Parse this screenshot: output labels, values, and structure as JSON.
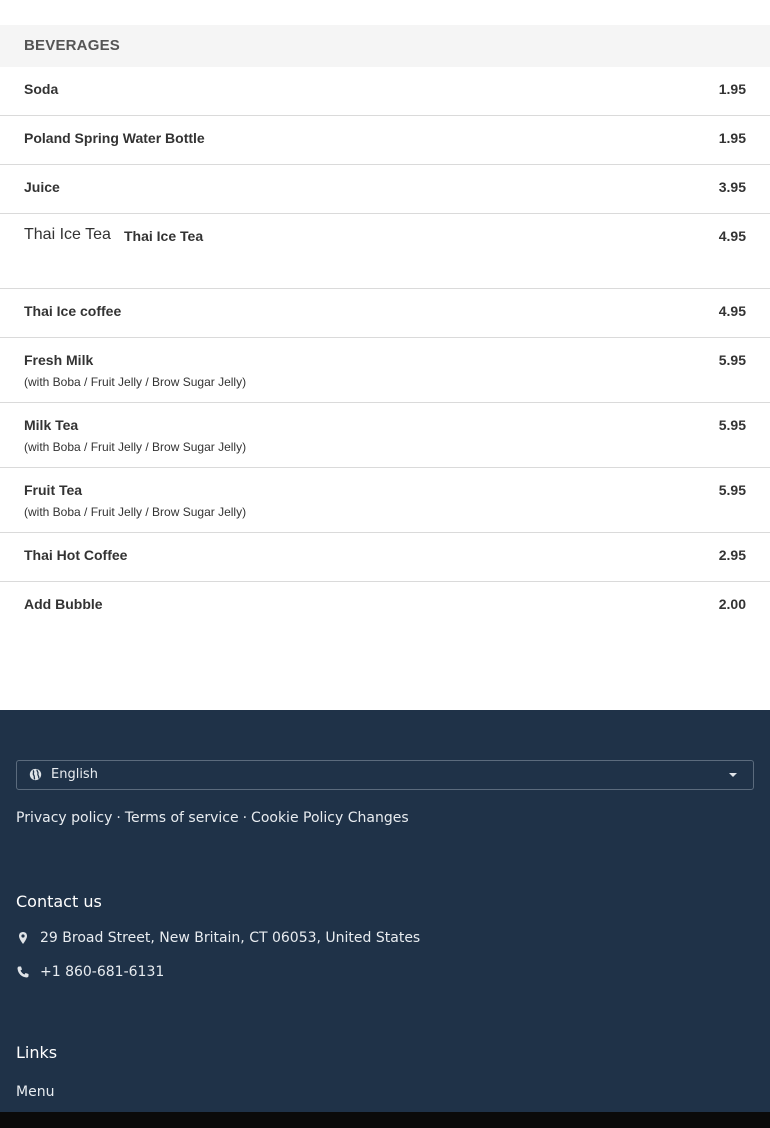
{
  "menu": {
    "section_title": "BEVERAGES",
    "items": [
      {
        "name": "Soda",
        "price": "1.95"
      },
      {
        "name": "Poland Spring Water Bottle",
        "price": "1.95"
      },
      {
        "name": "Juice",
        "price": "3.95"
      },
      {
        "name": "Thai Ice Tea",
        "price": "4.95",
        "image_alt": "Thai Ice Tea"
      },
      {
        "name": "Thai Ice coffee",
        "price": "4.95"
      },
      {
        "name": "Fresh Milk",
        "price": "5.95",
        "description": "(with Boba / Fruit Jelly / Brow Sugar Jelly)"
      },
      {
        "name": "Milk Tea",
        "price": "5.95",
        "description": "(with Boba / Fruit Jelly / Brow Sugar Jelly)"
      },
      {
        "name": "Fruit Tea",
        "price": "5.95",
        "description": "(with Boba / Fruit Jelly / Brow Sugar Jelly)"
      },
      {
        "name": "Thai Hot Coffee",
        "price": "2.95"
      },
      {
        "name": "Add Bubble",
        "price": "2.00"
      }
    ]
  },
  "footer": {
    "language": {
      "selected": "English",
      "icon": "globe-icon"
    },
    "legal_links": {
      "privacy": "Privacy policy",
      "terms": "Terms of service",
      "cookie": "Cookie Policy Changes",
      "separator": "·"
    },
    "contact": {
      "title": "Contact us",
      "address": "29 Broad Street, New Britain, CT 06053, United States",
      "phone": "+1 860-681-6131"
    },
    "links": {
      "title": "Links",
      "menu": "Menu"
    }
  },
  "colors": {
    "footer_bg": "#1f3248",
    "section_header_bg": "#f5f5f5",
    "text": "#333333",
    "divider": "#dadada"
  }
}
